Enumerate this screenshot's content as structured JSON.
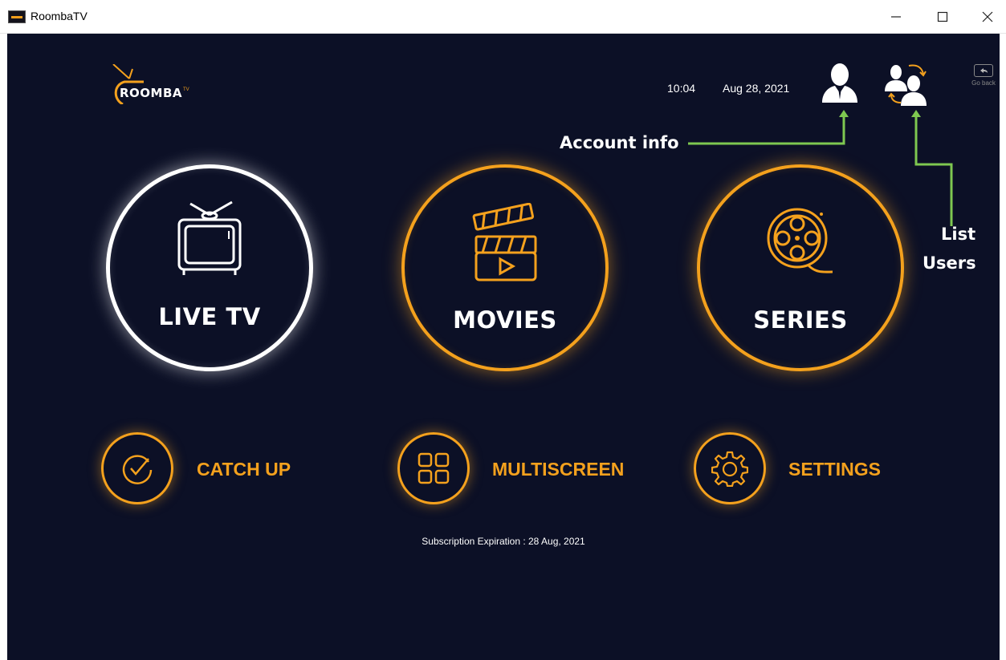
{
  "window": {
    "title": "RoombaTV",
    "minimize_glyph": "—",
    "maximize_glyph": "☐",
    "close_glyph": "✕"
  },
  "header": {
    "logo_text": "ROOMBA",
    "logo_superscript": "TV",
    "time": "10:04",
    "date": "Aug 28, 2021",
    "go_back_label": "Go back"
  },
  "annotations": {
    "account_info": "Account info",
    "list_users_line1": "List",
    "list_users_line2": "Users"
  },
  "main_menu": [
    {
      "label": "LIVE TV",
      "icon": "tv-icon"
    },
    {
      "label": "MOVIES",
      "icon": "clapperboard-icon"
    },
    {
      "label": "SERIES",
      "icon": "film-reel-icon"
    }
  ],
  "secondary_menu": [
    {
      "label": "CATCH UP",
      "icon": "checkmark-circle-icon"
    },
    {
      "label": "MULTISCREEN",
      "icon": "grid-icon"
    },
    {
      "label": "SETTINGS",
      "icon": "gear-icon"
    }
  ],
  "footer": {
    "subscription": "Subscription Expiration : 28 Aug, 2021"
  },
  "colors": {
    "background": "#0c1026",
    "accent": "#f4a11d",
    "annotation_arrow": "#7ec850"
  }
}
